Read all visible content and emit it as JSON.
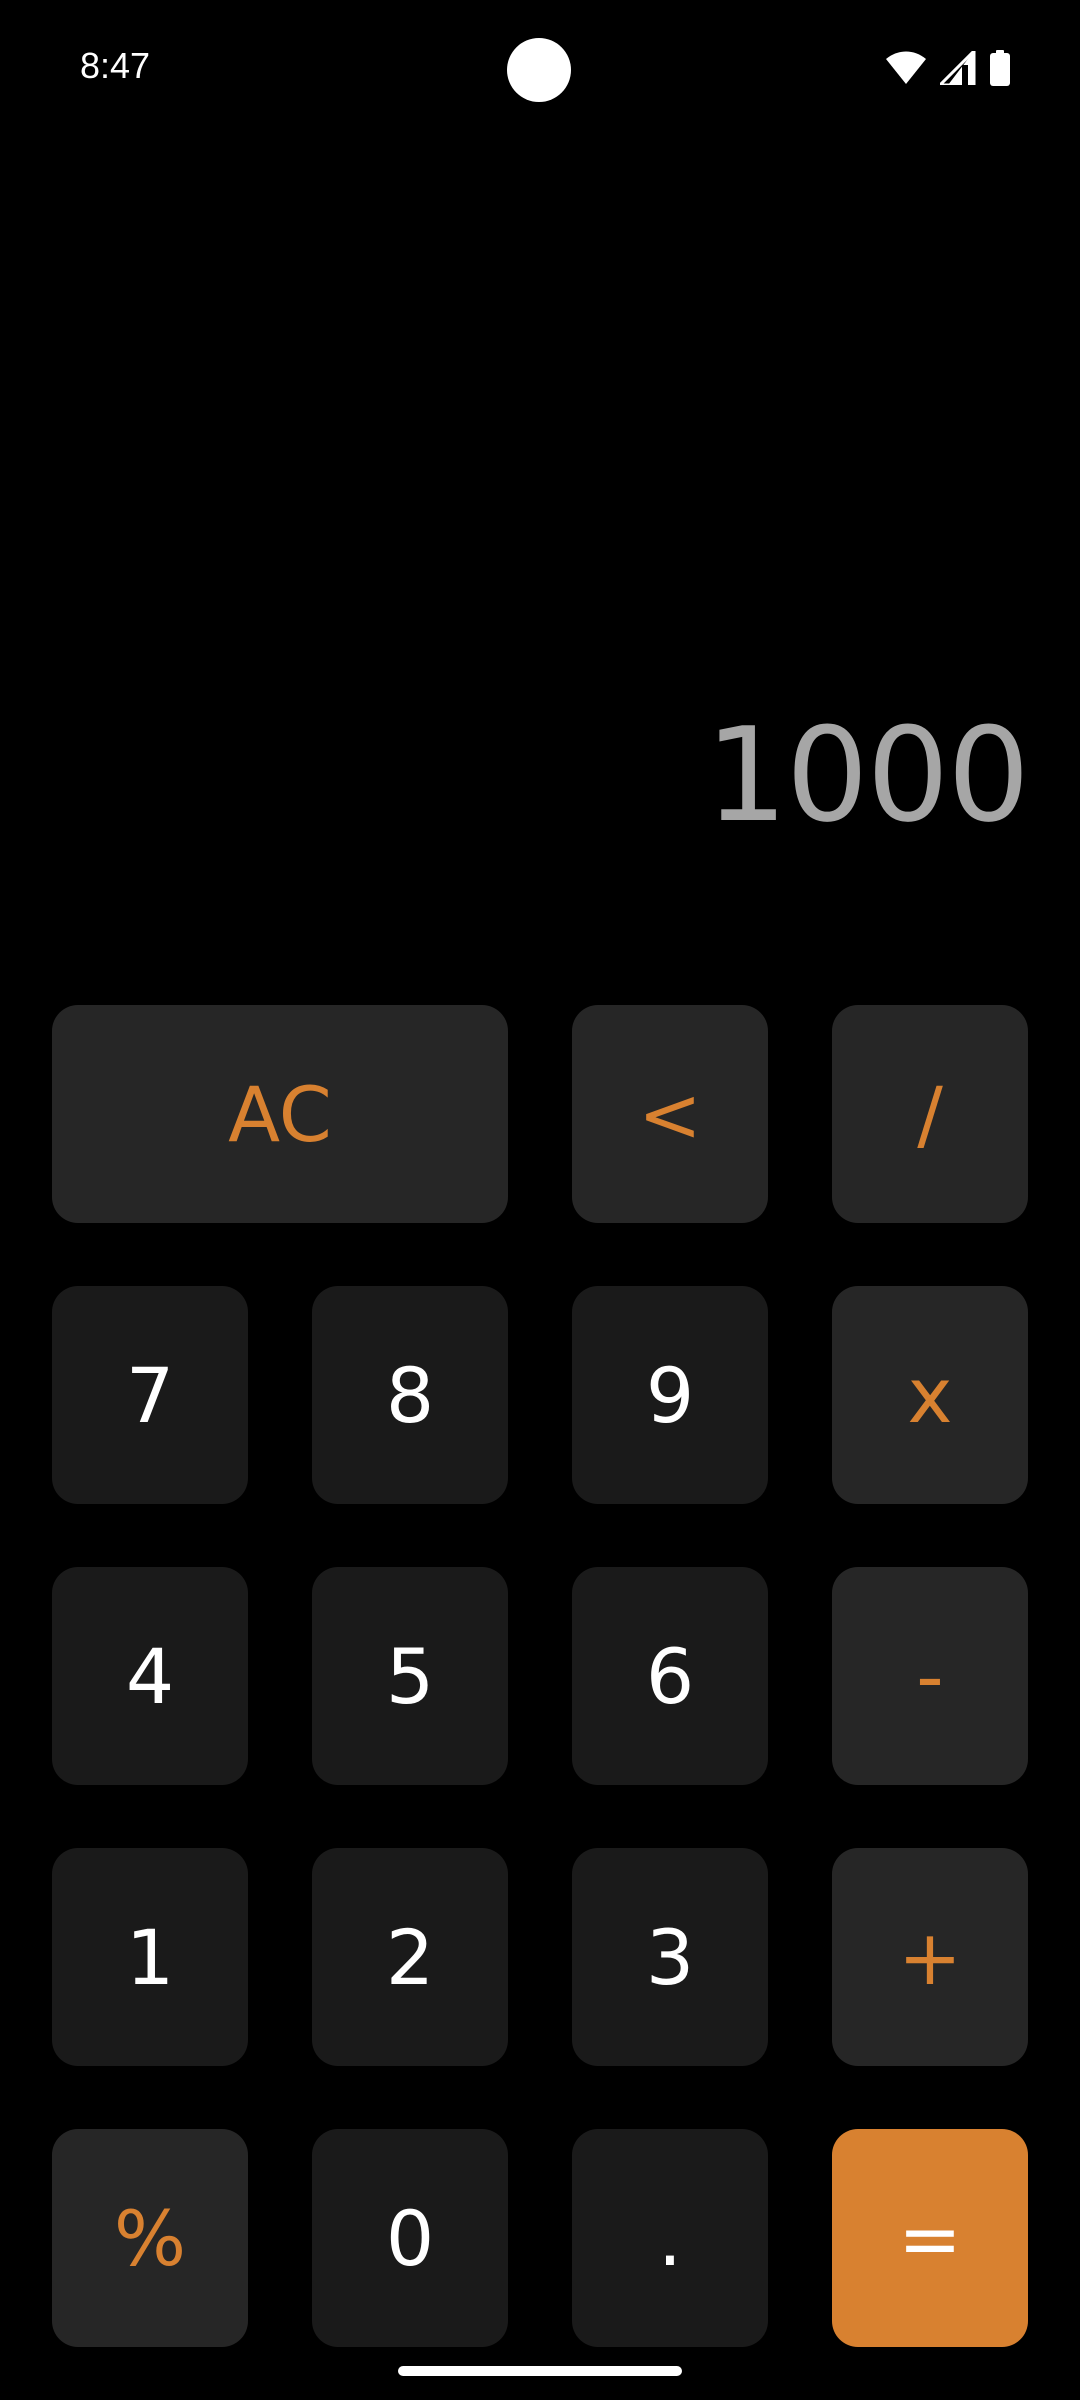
{
  "status_bar": {
    "time": "8:47",
    "icons": [
      "wifi-icon",
      "signal-icon",
      "battery-icon"
    ]
  },
  "display": {
    "value": "1000"
  },
  "keypad": {
    "rows": [
      [
        "AC",
        "<",
        "/"
      ],
      [
        "7",
        "8",
        "9",
        "x"
      ],
      [
        "4",
        "5",
        "6",
        "-"
      ],
      [
        "1",
        "2",
        "3",
        "+"
      ],
      [
        "%",
        "0",
        ".",
        "="
      ]
    ]
  },
  "colors": {
    "background": "#000000",
    "number_key": "#1a1a1a",
    "operator_key": "#262626",
    "accent": "#d88130",
    "display_text": "#a6a6a6"
  }
}
